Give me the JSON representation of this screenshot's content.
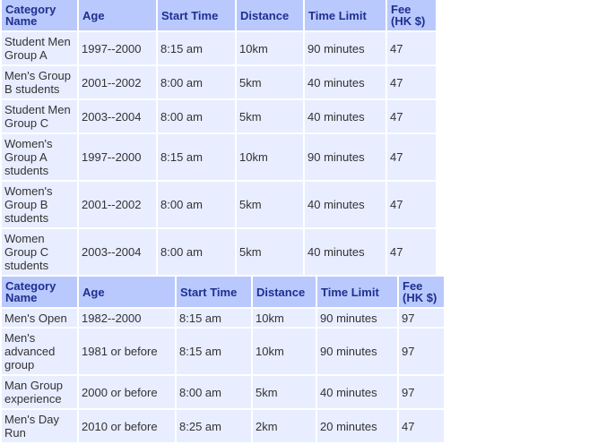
{
  "table1": {
    "headers": [
      "Category Name",
      "Age",
      "Start Time",
      "Distance",
      "Time Limit",
      "Fee (HK $)"
    ],
    "rows": [
      [
        "Student Men Group A",
        "1997--2000",
        "8:15 am",
        "10km",
        "90 minutes",
        "47"
      ],
      [
        "Men's Group B students",
        "2001--2002",
        "8:00 am",
        "5km",
        "40 minutes",
        "47"
      ],
      [
        "Student Men Group C",
        "2003--2004",
        "8:00 am",
        "5km",
        "40 minutes",
        "47"
      ],
      [
        "Women's Group A students",
        "1997--2000",
        "8:15 am",
        "10km",
        "90 minutes",
        "47"
      ],
      [
        "Women's Group B students",
        "2001--2002",
        "8:00 am",
        "5km",
        "40 minutes",
        "47"
      ],
      [
        "Women Group C students",
        "2003--2004",
        "8:00 am",
        "5km",
        "40 minutes",
        "47"
      ]
    ]
  },
  "table2": {
    "headers": [
      "Category Name",
      "Age",
      "Start Time",
      "Distance",
      "Time Limit",
      "Fee (HK $)"
    ],
    "rows": [
      [
        "Men's Open",
        "1982--2000",
        "8:15 am",
        "10km",
        "90 minutes",
        "97"
      ],
      [
        "Men's advanced group",
        "1981 or before",
        "8:15 am",
        "10km",
        "90 minutes",
        "97"
      ],
      [
        "Man Group experience",
        "2000 or before",
        "8:00 am",
        "5km",
        "40 minutes",
        "97"
      ],
      [
        "Men's Day Run",
        "2010 or before",
        "8:25 am",
        "2km",
        "20 minutes",
        "47"
      ]
    ]
  }
}
